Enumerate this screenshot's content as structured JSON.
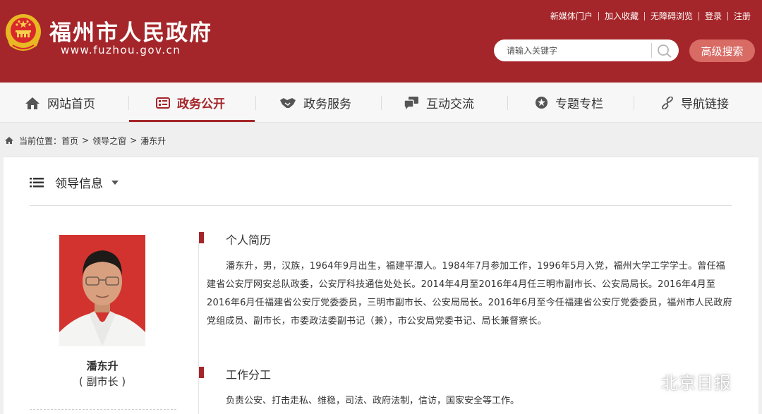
{
  "header": {
    "site_title": "福州市人民政府",
    "site_url": "www.fuzhou.gov.cn",
    "top_links": [
      "新媒体门户",
      "加入收藏",
      "无障碍浏览",
      "登录",
      "注册"
    ],
    "search_placeholder": "请输入关键字",
    "advanced_search_label": "高级搜索"
  },
  "nav": {
    "items": [
      {
        "label": "网站首页",
        "icon": "home-icon"
      },
      {
        "label": "政务公开",
        "icon": "document-list-icon",
        "active": true
      },
      {
        "label": "政务服务",
        "icon": "handshake-icon"
      },
      {
        "label": "互动交流",
        "icon": "chat-bubbles-icon"
      },
      {
        "label": "专题专栏",
        "icon": "star-circle-icon"
      },
      {
        "label": "导航链接",
        "icon": "link-icon"
      }
    ]
  },
  "breadcrumb": {
    "prefix": "当前位置：",
    "items": [
      "首页",
      "领导之窗",
      "潘东升"
    ],
    "separator": ">"
  },
  "panel": {
    "title": "领导信息"
  },
  "leader": {
    "name": "潘东升",
    "position": "( 副市长 )"
  },
  "sections": {
    "bio_title": "个人简历",
    "bio_text": "潘东升，男，汉族，1964年9月出生，福建平潭人。1984年7月参加工作，1996年5月入党，福州大学工学学士。曾任福建省公安厅网安总队政委，公安厅科技通信处处长。2014年4月至2016年4月任三明市副市长、公安局局长。2016年4月至2016年6月任福建省公安厅党委委员，三明市副市长、公安局局长。2016年6月至今任福建省公安厅党委委员，福州市人民政府党组成员、副市长，市委政法委副书记（兼），市公安局党委书记、局长兼督察长。",
    "duty_title": "工作分工",
    "duty_text": "负责公安、打击走私、维稳，司法、政府法制，信访，国家安全等工作。"
  },
  "watermark": {
    "text": "北京日报"
  },
  "colors": {
    "brand_red": "#a5262a",
    "advanced_button": "#d86b64",
    "nav_background": "#f7f7f7"
  }
}
